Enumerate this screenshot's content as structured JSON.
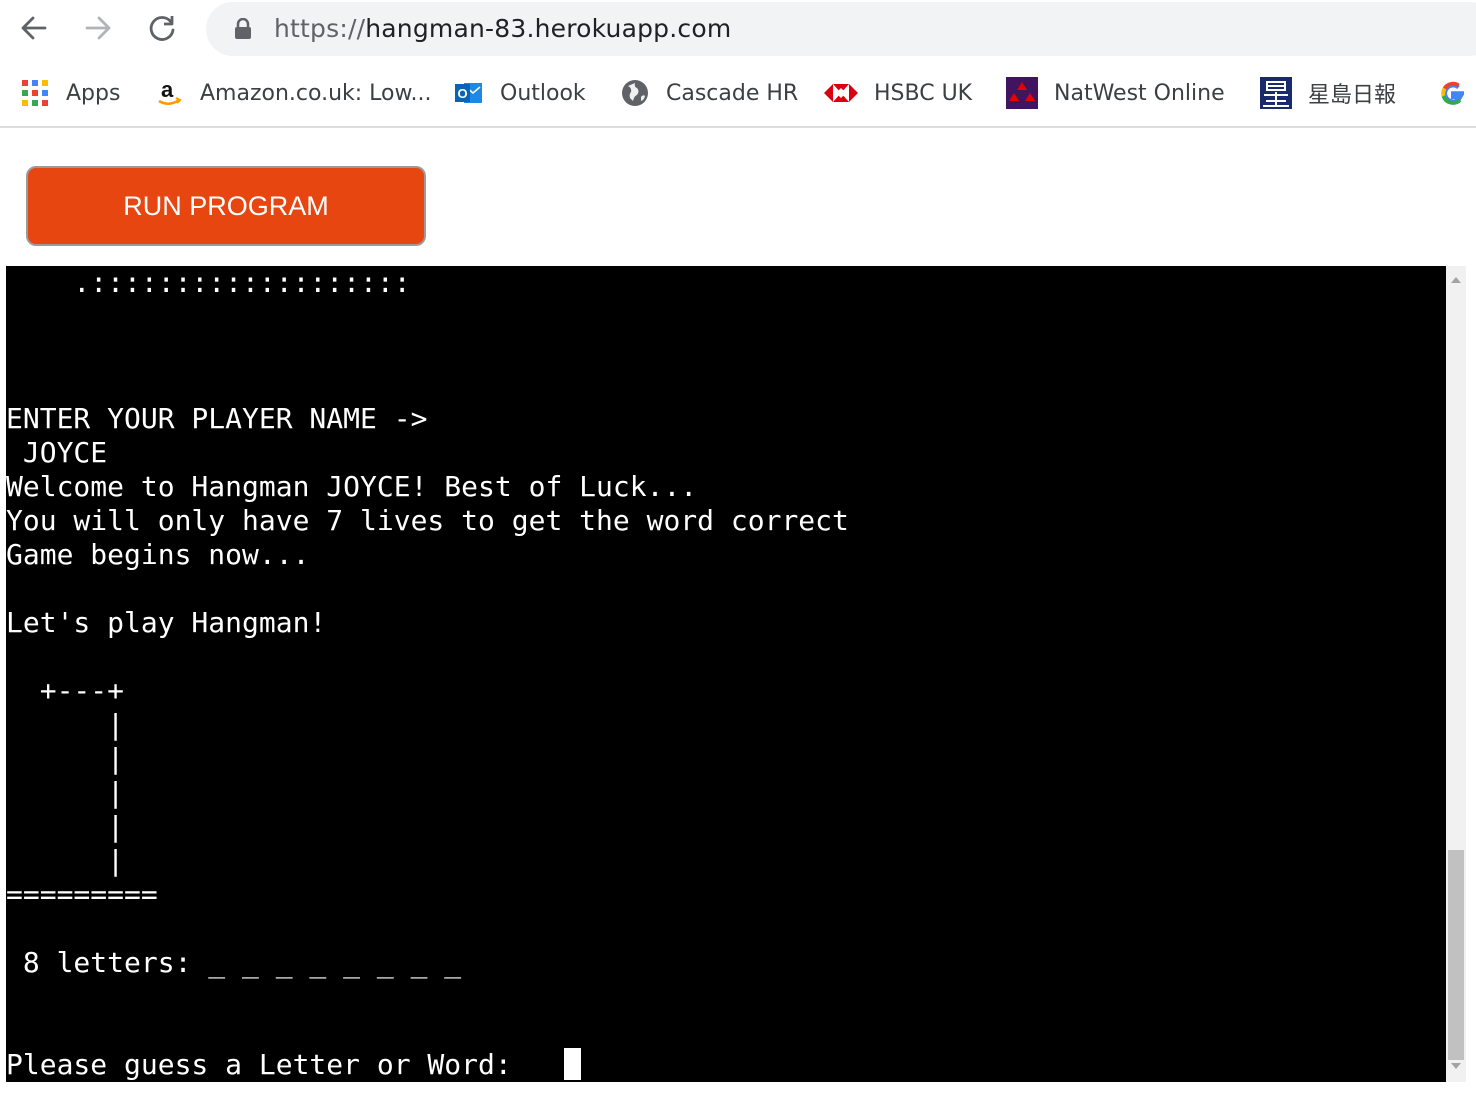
{
  "browser": {
    "url_protocol": "https://",
    "url_host": "hangman-83.herokuapp.com",
    "bookmarks": [
      {
        "label": "Apps",
        "icon": "apps-grid-icon"
      },
      {
        "label": "Amazon.co.uk: Low...",
        "icon": "amazon-icon"
      },
      {
        "label": "Outlook",
        "icon": "outlook-icon"
      },
      {
        "label": "Cascade HR",
        "icon": "globe-icon"
      },
      {
        "label": "HSBC UK",
        "icon": "hsbc-icon"
      },
      {
        "label": "NatWest Online",
        "icon": "natwest-icon"
      },
      {
        "label": "星島日報",
        "icon": "singtao-icon"
      }
    ]
  },
  "page": {
    "run_button_label": "RUN PROGRAM"
  },
  "terminal": {
    "output": "    .:::::::::::::::::::\n\n\n\nENTER YOUR PLAYER NAME ->\n JOYCE\nWelcome to Hangman JOYCE! Best of Luck...\nYou will only have 7 lives to get the word correct\nGame begins now...\n\nLet's play Hangman!\n\n  +---+\n      |\n      |\n      |\n      |\n      |\n=========\n\n 8 letters: _ _ _ _ _ _ _ _\n\n\nPlease guess a Letter or Word: "
  },
  "colors": {
    "run_button": "#e84610",
    "terminal_bg": "#000000",
    "terminal_fg": "#ffffff"
  }
}
